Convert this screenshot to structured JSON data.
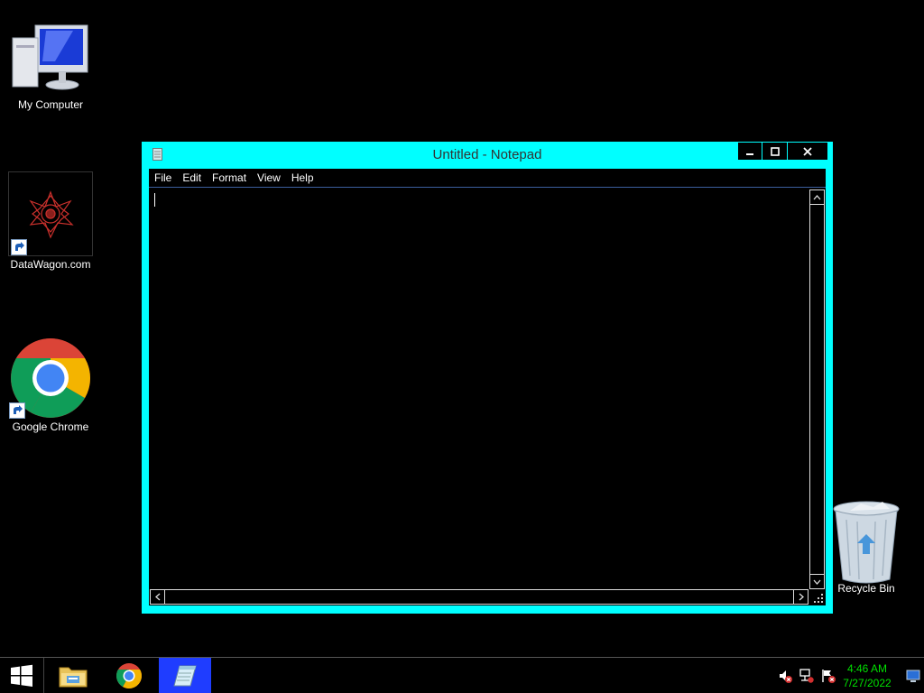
{
  "desktop": {
    "icons": [
      {
        "label": "My Computer"
      },
      {
        "label": "DataWagon.com"
      },
      {
        "label": "Google Chrome"
      },
      {
        "label": "Recycle Bin"
      }
    ]
  },
  "notepad": {
    "title": "Untitled - Notepad",
    "menu": [
      "File",
      "Edit",
      "Format",
      "View",
      "Help"
    ],
    "content": ""
  },
  "taskbar": {
    "items": [
      "start-icon",
      "file-explorer-icon",
      "chrome-icon",
      "notepad-icon"
    ],
    "tray": [
      "speaker-muted-icon",
      "network-icon",
      "action-center-flag-icon",
      "show-desktop-icon"
    ],
    "time": "4:46 AM",
    "date": "7/27/2022"
  },
  "colors": {
    "window_frame": "#00ffff",
    "desktop": "#000000",
    "clock": "#00e000",
    "active_task": "#1f3dff"
  }
}
